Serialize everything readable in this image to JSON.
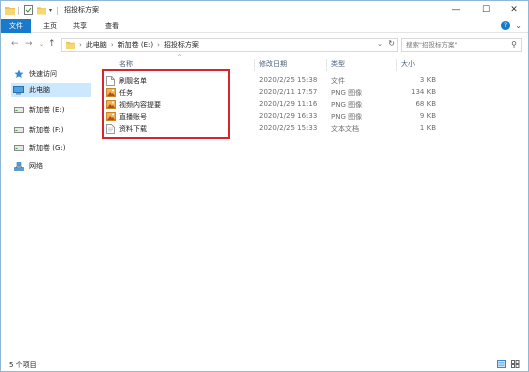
{
  "window": {
    "title": "招投标方案"
  },
  "ribbon": {
    "tabs": [
      "文件",
      "主页",
      "共享",
      "查看"
    ]
  },
  "address": {
    "segments": [
      "此电脑",
      "新加卷 (E:)",
      "招投标方案"
    ],
    "search_placeholder": "搜索\"招投标方案\""
  },
  "nav": {
    "quick_access": "快速访问",
    "this_pc": "此电脑",
    "drive_e": "新加卷 (E:)",
    "drive_f": "新加卷 (F:)",
    "drive_g": "新加卷 (G:)",
    "network": "网络"
  },
  "columns": {
    "name": "名称",
    "date": "修改日期",
    "type": "类型",
    "size": "大小"
  },
  "files": [
    {
      "name": "刷靓名单",
      "date": "2020/2/25 15:38",
      "type": "文件",
      "size": "3 KB",
      "icon": "file-icon"
    },
    {
      "name": "任务",
      "date": "2020/2/11 17:57",
      "type": "PNG 图像",
      "size": "134 KB",
      "icon": "png-image-icon"
    },
    {
      "name": "视频内容提要",
      "date": "2020/1/29 11:16",
      "type": "PNG 图像",
      "size": "68 KB",
      "icon": "png-image-icon"
    },
    {
      "name": "直播账号",
      "date": "2020/1/29 16:33",
      "type": "PNG 图像",
      "size": "9 KB",
      "icon": "png-image-icon"
    },
    {
      "name": "资料下载",
      "date": "2020/2/25 15:33",
      "type": "文本文档",
      "size": "1 KB",
      "icon": "text-document-icon"
    }
  ],
  "status": {
    "item_count": "5 个项目"
  },
  "colors": {
    "accent": "#1979ca",
    "highlight_border": "#d9242e",
    "selected_nav": "#cce8ff"
  }
}
